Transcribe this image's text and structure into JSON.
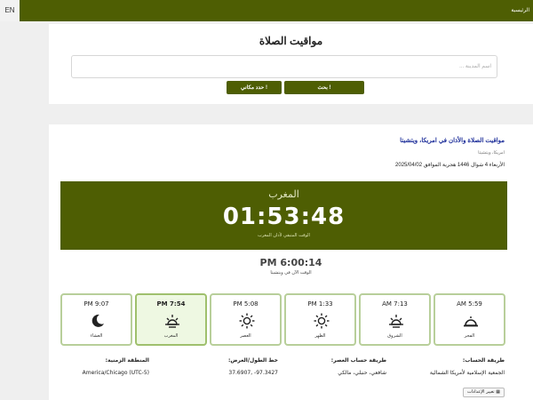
{
  "topbar": {
    "lang": "EN",
    "home": "الرئيسية"
  },
  "search": {
    "title": "مواقيت الصلاة",
    "placeholder": "اسم المدينة ...",
    "search_button": "بحث !",
    "locate_button": "حدد مكاني !"
  },
  "location": {
    "heading": "مواقيت الصلاة والأذان في امريكا، ويتشيتا",
    "region": "امريكا، ويتشيتا",
    "date": "الأربعاء 4 شوال 1446 هجرية الموافق 2025/04/02"
  },
  "countdown": {
    "prayer_name": "المغرب",
    "remaining": "01:53:48",
    "caption": "الوقت المتبقي لأذان المغرب"
  },
  "clock": {
    "time": "PM 6:00:14",
    "caption": "الوقت الآن في ويتشيتا"
  },
  "prayers": [
    {
      "name": "العشاء",
      "time": "PM 9:07",
      "icon": "moon-icon",
      "active": false
    },
    {
      "name": "المغرب",
      "time": "PM 7:54",
      "icon": "sunset-icon",
      "active": true
    },
    {
      "name": "العصر",
      "time": "PM 5:08",
      "icon": "sun-icon",
      "active": false
    },
    {
      "name": "الظهر",
      "time": "PM 1:33",
      "icon": "sun-icon",
      "active": false
    },
    {
      "name": "الشروق",
      "time": "AM 7:13",
      "icon": "sunrise-icon",
      "active": false
    },
    {
      "name": "الفجر",
      "time": "AM 5:59",
      "icon": "dawn-icon",
      "active": false
    }
  ],
  "settings": {
    "calc_method_label": "طريقة الحساب:",
    "calc_method_value": "الجمعية الإسلامية لأمريكا الشمالية",
    "asr_label": "طريقة حساب العصر:",
    "asr_value": "شافعي، حنبلي، مالكي",
    "coords_label": "خط الطول/العرض:",
    "coords_value": "97.3427- ,37.6907",
    "tz_label": "المنطقة الزمنية:",
    "tz_value": "America/Chicago (UTC-5)",
    "change_button": "تغيير الإعدادات"
  },
  "colors": {
    "brand": "#4e5e03",
    "tile_border": "#b8cf9a",
    "active_tile": "#eef8e2",
    "link": "#1e2f9a"
  }
}
